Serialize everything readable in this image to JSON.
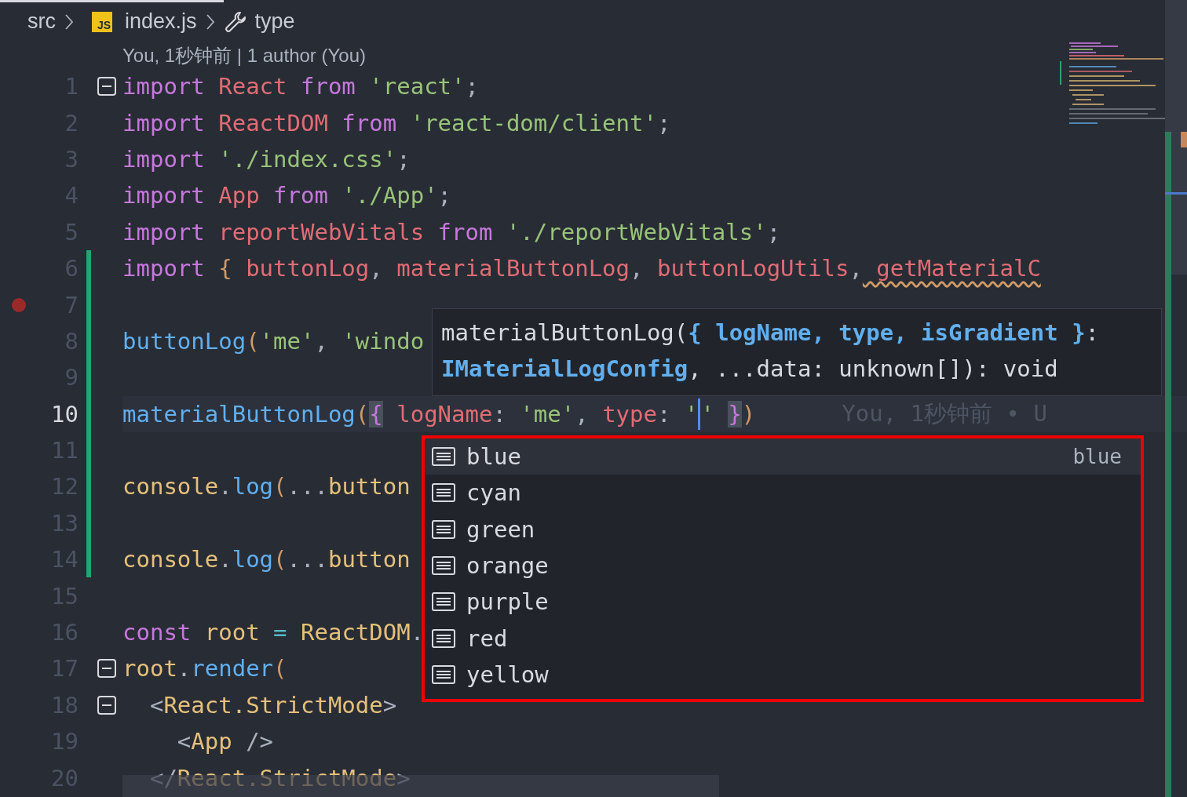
{
  "breadcrumbs": [
    {
      "label": "src",
      "kind": "folder"
    },
    {
      "label": "index.js",
      "kind": "file",
      "badge": "JS"
    },
    {
      "label": "type",
      "kind": "symbol"
    }
  ],
  "codelens": "You, 1秒钟前 | 1 author (You)",
  "lines": [
    {
      "number": "1",
      "expanded": true,
      "tokens": [
        {
          "text": "import",
          "kind": "keyword"
        },
        {
          "text": " React",
          "kind": "variable"
        },
        {
          "text": " from",
          "kind": "keyword"
        },
        {
          "text": " 'react'",
          "kind": "string"
        },
        {
          "text": ";",
          "kind": "punctuation"
        }
      ]
    },
    {
      "number": "2",
      "tokens": [
        {
          "text": "import",
          "kind": "keyword"
        },
        {
          "text": " ReactDOM",
          "kind": "variable"
        },
        {
          "text": " from",
          "kind": "keyword"
        },
        {
          "text": " 'react-dom/client'",
          "kind": "string"
        },
        {
          "text": ";",
          "kind": "punctuation"
        }
      ]
    },
    {
      "number": "3",
      "tokens": [
        {
          "text": "import",
          "kind": "keyword"
        },
        {
          "text": " './index.css'",
          "kind": "string"
        },
        {
          "text": ";",
          "kind": "punctuation"
        }
      ]
    },
    {
      "number": "4",
      "tokens": [
        {
          "text": "import",
          "kind": "keyword"
        },
        {
          "text": " App",
          "kind": "variable"
        },
        {
          "text": " from",
          "kind": "keyword"
        },
        {
          "text": " './App'",
          "kind": "string"
        },
        {
          "text": ";",
          "kind": "punctuation"
        }
      ]
    },
    {
      "number": "5",
      "tokens": [
        {
          "text": "import",
          "kind": "keyword"
        },
        {
          "text": " reportWebVitals",
          "kind": "variable"
        },
        {
          "text": " from",
          "kind": "keyword"
        },
        {
          "text": " './reportWebVitals'",
          "kind": "string"
        },
        {
          "text": ";",
          "kind": "punctuation"
        }
      ]
    },
    {
      "number": "6",
      "changed": true,
      "tokens": [
        {
          "text": "import",
          "kind": "keyword"
        },
        {
          "text": " {",
          "kind": "bracket"
        },
        {
          "text": " buttonLog",
          "kind": "variable"
        },
        {
          "text": ",",
          "kind": "punctuation"
        },
        {
          "text": " materialButtonLog",
          "kind": "variable"
        },
        {
          "text": ",",
          "kind": "punctuation"
        },
        {
          "text": " buttonLogUtils",
          "kind": "variable"
        },
        {
          "text": ",",
          "kind": "punctuation"
        },
        {
          "text": " getMaterialC",
          "kind": "variable",
          "warning": true
        }
      ]
    },
    {
      "number": "7",
      "changed": true,
      "breakpoint": true
    },
    {
      "number": "8",
      "changed": true,
      "tokens": [
        {
          "text": "buttonLog",
          "kind": "function"
        },
        {
          "text": "(",
          "kind": "bracket"
        },
        {
          "text": "'me'",
          "kind": "string"
        },
        {
          "text": ",",
          "kind": "punctuation"
        },
        {
          "text": " 'windo",
          "kind": "string"
        }
      ]
    },
    {
      "number": "9",
      "changed": true
    },
    {
      "number": "10",
      "changed": true,
      "current": true,
      "blame": "You, 1秒钟前 • U",
      "tokens": [
        {
          "text": "materialButtonLog",
          "kind": "function"
        },
        {
          "text": "(",
          "kind": "bracket"
        },
        {
          "text": "{",
          "kind": "brace",
          "matched": true
        },
        {
          "text": " logName",
          "kind": "variable"
        },
        {
          "text": ":",
          "kind": "punctuation"
        },
        {
          "text": " 'me'",
          "kind": "string"
        },
        {
          "text": ",",
          "kind": "punctuation"
        },
        {
          "text": " type",
          "kind": "variable"
        },
        {
          "text": ":",
          "kind": "punctuation"
        },
        {
          "text": " '",
          "kind": "string"
        },
        {
          "text": "' ",
          "kind": "string",
          "caret": true
        },
        {
          "text": "}",
          "kind": "brace",
          "matched": true
        },
        {
          "text": ")",
          "kind": "bracket"
        }
      ]
    },
    {
      "number": "11",
      "changed": true
    },
    {
      "number": "12",
      "changed": true,
      "tokens": [
        {
          "text": "console",
          "kind": "class"
        },
        {
          "text": ".",
          "kind": "punctuation"
        },
        {
          "text": "log",
          "kind": "function"
        },
        {
          "text": "(",
          "kind": "bracket"
        },
        {
          "text": "...",
          "kind": "punctuation"
        },
        {
          "text": "button",
          "kind": "class"
        }
      ]
    },
    {
      "number": "13",
      "changed": true
    },
    {
      "number": "14",
      "changed": true,
      "tokens": [
        {
          "text": "console",
          "kind": "class"
        },
        {
          "text": ".",
          "kind": "punctuation"
        },
        {
          "text": "log",
          "kind": "function"
        },
        {
          "text": "(",
          "kind": "bracket"
        },
        {
          "text": "...",
          "kind": "punctuation"
        },
        {
          "text": "button",
          "kind": "class"
        }
      ]
    },
    {
      "number": "15"
    },
    {
      "number": "16",
      "tokens": [
        {
          "text": "const",
          "kind": "keyword"
        },
        {
          "text": " root",
          "kind": "class"
        },
        {
          "text": " =",
          "kind": "operator"
        },
        {
          "text": " ReactDOM",
          "kind": "class"
        },
        {
          "text": ".",
          "kind": "punctuation"
        }
      ]
    },
    {
      "number": "17",
      "expanded": true,
      "tokens": [
        {
          "text": "root",
          "kind": "class"
        },
        {
          "text": ".",
          "kind": "punctuation"
        },
        {
          "text": "render",
          "kind": "function"
        },
        {
          "text": "(",
          "kind": "bracket"
        }
      ]
    },
    {
      "number": "18",
      "expanded": true,
      "tokens": [
        {
          "text": "  <",
          "kind": "punctuation"
        },
        {
          "text": "React.StrictMode",
          "kind": "class"
        },
        {
          "text": ">",
          "kind": "punctuation"
        }
      ]
    },
    {
      "number": "19",
      "tokens": [
        {
          "text": "    <",
          "kind": "punctuation"
        },
        {
          "text": "App",
          "kind": "class"
        },
        {
          "text": " />",
          "kind": "punctuation"
        }
      ]
    },
    {
      "number": "20",
      "tokens": [
        {
          "text": "  </",
          "kind": "punctuation"
        },
        {
          "text": "React.StrictMode",
          "kind": "class"
        },
        {
          "text": ">",
          "kind": "punctuation"
        }
      ]
    }
  ],
  "signature_hint": [
    {
      "text": "materialButtonLog(",
      "kind": "plain"
    },
    {
      "text": "{ logName, type, isGradient }",
      "kind": "parameter"
    },
    {
      "text": ":",
      "kind": "plain"
    },
    {
      "text": " IMaterialLogConfig",
      "kind": "parameter"
    },
    {
      "text": ", ...data: unknown[]): void",
      "kind": "plain"
    }
  ],
  "suggestions": [
    {
      "label": "blue",
      "selected": true,
      "detail": "blue"
    },
    {
      "label": "cyan",
      "selected": false
    },
    {
      "label": "green",
      "selected": false
    },
    {
      "label": "orange",
      "selected": false
    },
    {
      "label": "purple",
      "selected": false
    },
    {
      "label": "red",
      "selected": false
    },
    {
      "label": "yellow",
      "selected": false
    }
  ]
}
